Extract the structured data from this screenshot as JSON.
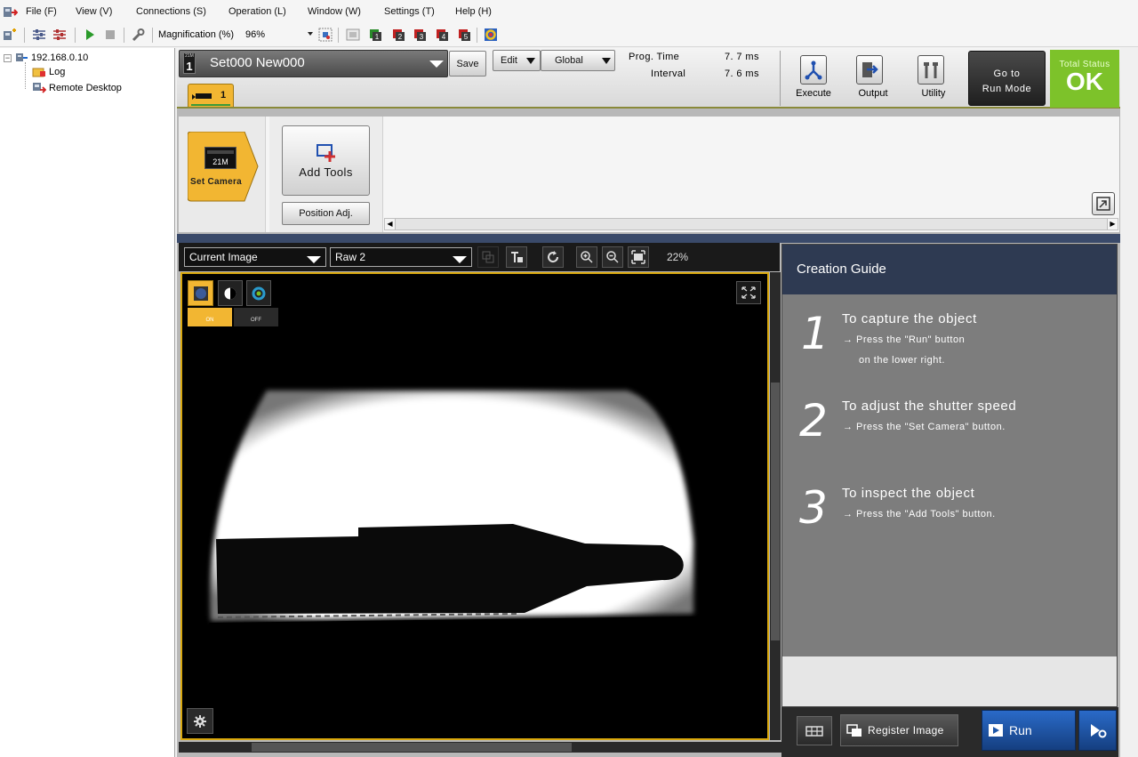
{
  "menu": {
    "file": "File (F)",
    "view": "View (V)",
    "connections": "Connections (S)",
    "operation": "Operation (L)",
    "window": "Window (W)",
    "settings": "Settings (T)",
    "help": "Help (H)"
  },
  "toolbar": {
    "magnification_label": "Magnification (%)",
    "magnification_value": "96%"
  },
  "tree": {
    "root": "192.168.0.10",
    "children": [
      "Log",
      "Remote Desktop"
    ]
  },
  "header": {
    "badge": "21M",
    "set_number": "1",
    "set_title": "Set000  New000",
    "save": "Save",
    "edit": "Edit",
    "global": "Global",
    "prog_time_label": "Prog. Time",
    "prog_time_value": "7. 7  ms",
    "interval_label": "Interval",
    "interval_value": "7. 6  ms",
    "execute": "Execute",
    "output": "Output",
    "utility": "Utility",
    "run_mode_line1": "Go to",
    "run_mode_line2": "Run Mode",
    "total_status_label": "Total Status",
    "total_status_value": "OK",
    "tab_label": "1"
  },
  "flow": {
    "camera_badge": "21M",
    "set_camera": "Set Camera",
    "add_tools": "Add Tools",
    "position_adj": "Position Adj."
  },
  "viewer": {
    "image_select": "Current Image",
    "raw_select": "Raw 2",
    "zoom": "22%",
    "on_label": "ON",
    "off_label": "OFF"
  },
  "guide": {
    "title": "Creation Guide",
    "steps": [
      {
        "num": "1",
        "title": "To capture the object",
        "line1": "→ Press the \"Run\" button",
        "line2": "on the lower right."
      },
      {
        "num": "2",
        "title": "To adjust the shutter speed",
        "line1": "→ Press the \"Set Camera\" button.",
        "line2": ""
      },
      {
        "num": "3",
        "title": "To inspect the object",
        "line1": "→ Press the \"Add Tools\" button.",
        "line2": ""
      }
    ]
  },
  "bottom": {
    "register_image": "Register Image",
    "run": "Run"
  },
  "colors": {
    "accent_yellow": "#f2b632",
    "status_ok": "#7dc22a",
    "guide_header": "#2e3a52",
    "run_button": "#1e56a8"
  }
}
